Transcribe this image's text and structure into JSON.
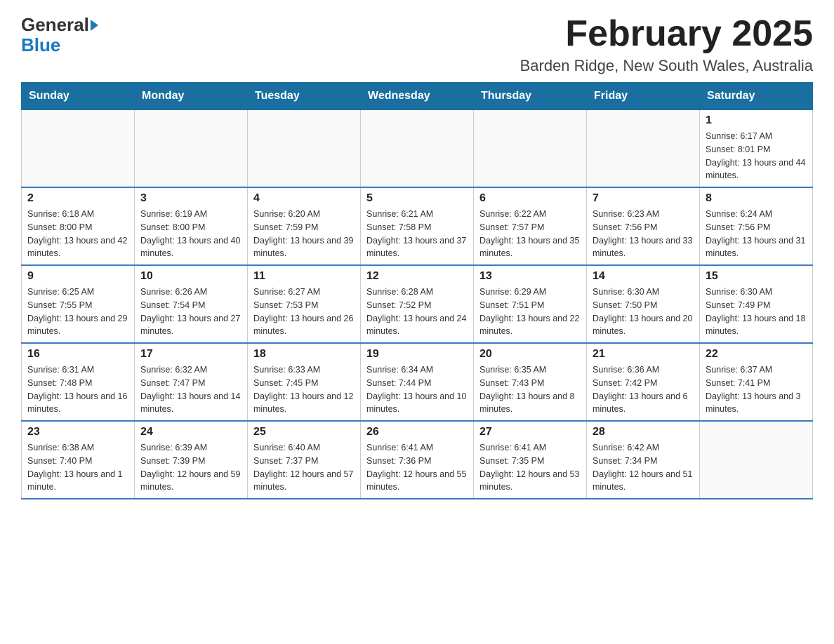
{
  "header": {
    "logo": {
      "line1": "General",
      "line2": "Blue"
    },
    "title": "February 2025",
    "subtitle": "Barden Ridge, New South Wales, Australia"
  },
  "calendar": {
    "days_of_week": [
      "Sunday",
      "Monday",
      "Tuesday",
      "Wednesday",
      "Thursday",
      "Friday",
      "Saturday"
    ],
    "weeks": [
      {
        "days": [
          {
            "date": "",
            "info": ""
          },
          {
            "date": "",
            "info": ""
          },
          {
            "date": "",
            "info": ""
          },
          {
            "date": "",
            "info": ""
          },
          {
            "date": "",
            "info": ""
          },
          {
            "date": "",
            "info": ""
          },
          {
            "date": "1",
            "info": "Sunrise: 6:17 AM\nSunset: 8:01 PM\nDaylight: 13 hours and 44 minutes."
          }
        ]
      },
      {
        "days": [
          {
            "date": "2",
            "info": "Sunrise: 6:18 AM\nSunset: 8:00 PM\nDaylight: 13 hours and 42 minutes."
          },
          {
            "date": "3",
            "info": "Sunrise: 6:19 AM\nSunset: 8:00 PM\nDaylight: 13 hours and 40 minutes."
          },
          {
            "date": "4",
            "info": "Sunrise: 6:20 AM\nSunset: 7:59 PM\nDaylight: 13 hours and 39 minutes."
          },
          {
            "date": "5",
            "info": "Sunrise: 6:21 AM\nSunset: 7:58 PM\nDaylight: 13 hours and 37 minutes."
          },
          {
            "date": "6",
            "info": "Sunrise: 6:22 AM\nSunset: 7:57 PM\nDaylight: 13 hours and 35 minutes."
          },
          {
            "date": "7",
            "info": "Sunrise: 6:23 AM\nSunset: 7:56 PM\nDaylight: 13 hours and 33 minutes."
          },
          {
            "date": "8",
            "info": "Sunrise: 6:24 AM\nSunset: 7:56 PM\nDaylight: 13 hours and 31 minutes."
          }
        ]
      },
      {
        "days": [
          {
            "date": "9",
            "info": "Sunrise: 6:25 AM\nSunset: 7:55 PM\nDaylight: 13 hours and 29 minutes."
          },
          {
            "date": "10",
            "info": "Sunrise: 6:26 AM\nSunset: 7:54 PM\nDaylight: 13 hours and 27 minutes."
          },
          {
            "date": "11",
            "info": "Sunrise: 6:27 AM\nSunset: 7:53 PM\nDaylight: 13 hours and 26 minutes."
          },
          {
            "date": "12",
            "info": "Sunrise: 6:28 AM\nSunset: 7:52 PM\nDaylight: 13 hours and 24 minutes."
          },
          {
            "date": "13",
            "info": "Sunrise: 6:29 AM\nSunset: 7:51 PM\nDaylight: 13 hours and 22 minutes."
          },
          {
            "date": "14",
            "info": "Sunrise: 6:30 AM\nSunset: 7:50 PM\nDaylight: 13 hours and 20 minutes."
          },
          {
            "date": "15",
            "info": "Sunrise: 6:30 AM\nSunset: 7:49 PM\nDaylight: 13 hours and 18 minutes."
          }
        ]
      },
      {
        "days": [
          {
            "date": "16",
            "info": "Sunrise: 6:31 AM\nSunset: 7:48 PM\nDaylight: 13 hours and 16 minutes."
          },
          {
            "date": "17",
            "info": "Sunrise: 6:32 AM\nSunset: 7:47 PM\nDaylight: 13 hours and 14 minutes."
          },
          {
            "date": "18",
            "info": "Sunrise: 6:33 AM\nSunset: 7:45 PM\nDaylight: 13 hours and 12 minutes."
          },
          {
            "date": "19",
            "info": "Sunrise: 6:34 AM\nSunset: 7:44 PM\nDaylight: 13 hours and 10 minutes."
          },
          {
            "date": "20",
            "info": "Sunrise: 6:35 AM\nSunset: 7:43 PM\nDaylight: 13 hours and 8 minutes."
          },
          {
            "date": "21",
            "info": "Sunrise: 6:36 AM\nSunset: 7:42 PM\nDaylight: 13 hours and 6 minutes."
          },
          {
            "date": "22",
            "info": "Sunrise: 6:37 AM\nSunset: 7:41 PM\nDaylight: 13 hours and 3 minutes."
          }
        ]
      },
      {
        "days": [
          {
            "date": "23",
            "info": "Sunrise: 6:38 AM\nSunset: 7:40 PM\nDaylight: 13 hours and 1 minute."
          },
          {
            "date": "24",
            "info": "Sunrise: 6:39 AM\nSunset: 7:39 PM\nDaylight: 12 hours and 59 minutes."
          },
          {
            "date": "25",
            "info": "Sunrise: 6:40 AM\nSunset: 7:37 PM\nDaylight: 12 hours and 57 minutes."
          },
          {
            "date": "26",
            "info": "Sunrise: 6:41 AM\nSunset: 7:36 PM\nDaylight: 12 hours and 55 minutes."
          },
          {
            "date": "27",
            "info": "Sunrise: 6:41 AM\nSunset: 7:35 PM\nDaylight: 12 hours and 53 minutes."
          },
          {
            "date": "28",
            "info": "Sunrise: 6:42 AM\nSunset: 7:34 PM\nDaylight: 12 hours and 51 minutes."
          },
          {
            "date": "",
            "info": ""
          }
        ]
      }
    ]
  }
}
